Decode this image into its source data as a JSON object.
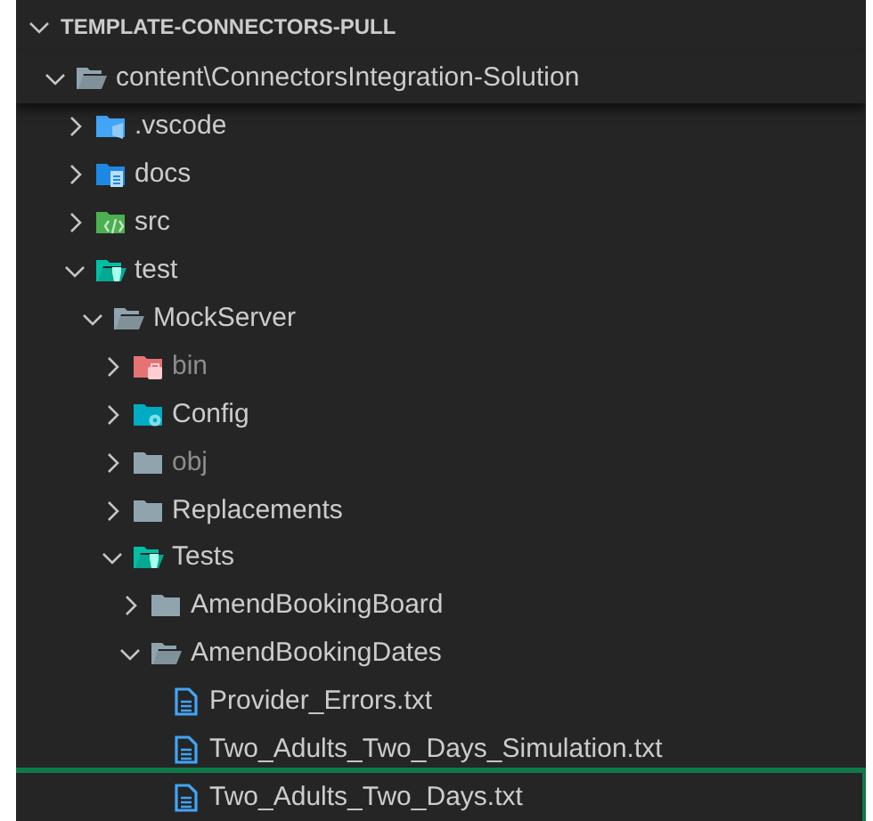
{
  "explorer": {
    "title": "TEMPLATE-CONNECTORS-PULL",
    "expanded": true,
    "root": {
      "name": "content\\ConnectorsIntegration-Solution",
      "kind": "folder",
      "expanded": true,
      "children": [
        {
          "name": ".vscode",
          "kind": "vscode-folder",
          "expanded": false
        },
        {
          "name": "docs",
          "kind": "docs-folder",
          "expanded": false
        },
        {
          "name": "src",
          "kind": "source-folder",
          "expanded": false
        },
        {
          "name": "test",
          "kind": "test-folder",
          "expanded": true,
          "children": [
            {
              "name": "MockServer",
              "kind": "folder",
              "expanded": true,
              "children": [
                {
                  "name": "bin",
                  "kind": "bin-folder",
                  "expanded": false,
                  "dimmed": true
                },
                {
                  "name": "Config",
                  "kind": "config-folder",
                  "expanded": false,
                  "dimmed": false
                },
                {
                  "name": "obj",
                  "kind": "folder",
                  "expanded": false,
                  "dimmed": true
                },
                {
                  "name": "Replacements",
                  "kind": "folder",
                  "expanded": false,
                  "dimmed": false
                },
                {
                  "name": "Tests",
                  "kind": "test-folder",
                  "expanded": true,
                  "children": [
                    {
                      "name": "AmendBookingBoard",
                      "kind": "folder",
                      "expanded": false
                    },
                    {
                      "name": "AmendBookingDates",
                      "kind": "folder",
                      "expanded": true,
                      "children": [
                        {
                          "name": "Provider_Errors.txt",
                          "kind": "file",
                          "highlighted": false
                        },
                        {
                          "name": "Two_Adults_Two_Days_Simulation.txt",
                          "kind": "file",
                          "highlighted": false
                        },
                        {
                          "name": "Two_Adults_Two_Days.txt",
                          "kind": "file",
                          "highlighted": true
                        }
                      ]
                    }
                  ]
                }
              ]
            }
          ]
        }
      ]
    }
  }
}
